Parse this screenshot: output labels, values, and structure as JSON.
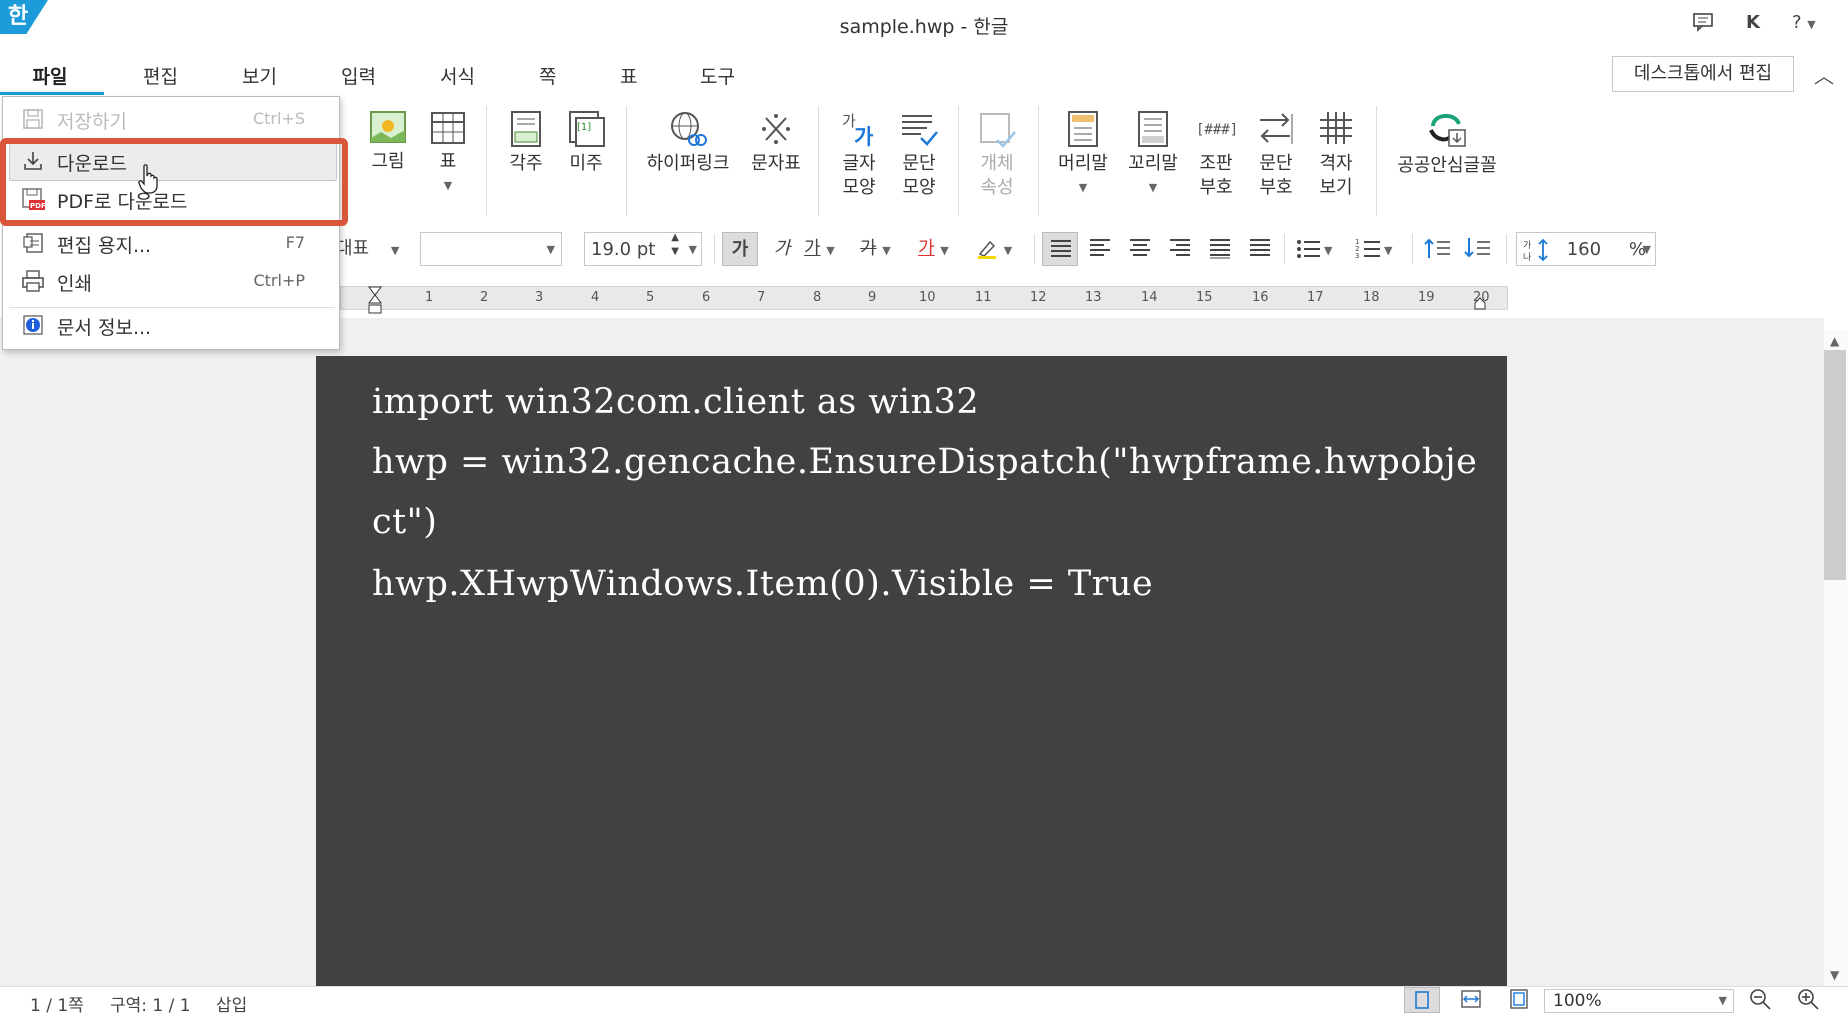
{
  "window": {
    "title": "sample.hwp - 한글",
    "app_logo": "한",
    "user_initial": "K",
    "help_label": "?"
  },
  "menu": {
    "tabs": [
      "파일",
      "편집",
      "보기",
      "입력",
      "서식",
      "쪽",
      "표",
      "도구"
    ],
    "desktop_edit": "데스크톱에서 편집"
  },
  "ribbon": {
    "picture": "그림",
    "table": "표",
    "footnote": "각주",
    "endnote": "미주",
    "hyperlink": "하이퍼링크",
    "char_map": "문자표",
    "char_shape_l1": "글자",
    "char_shape_l2": "모양",
    "para_shape_l1": "문단",
    "para_shape_l2": "모양",
    "obj_props_l1": "개체",
    "obj_props_l2": "속성",
    "header": "머리말",
    "footer": "꼬리말",
    "markup_l1": "조판",
    "markup_l2": "부호",
    "para_mark_l1": "문단",
    "para_mark_l2": "부호",
    "grid_l1": "격자",
    "grid_l2": "보기",
    "public_font": "공공안심글꼴"
  },
  "formatbar": {
    "style_partial": "대표",
    "font_name": "",
    "font_size": "19.0",
    "font_unit": "pt",
    "bold": "가",
    "italic": "가",
    "underline": "가",
    "strike": "가",
    "color": "가",
    "line_spacing": "160",
    "line_spacing_unit": "%"
  },
  "ruler": {
    "numbers": [
      "1",
      "2",
      "3",
      "4",
      "5",
      "6",
      "7",
      "8",
      "9",
      "10",
      "11",
      "12",
      "13",
      "14",
      "15",
      "16",
      "17",
      "18",
      "19",
      "20"
    ]
  },
  "document": {
    "lines": [
      "import  win32com.client  as  win32",
      "hwp  =  win32.gencache.EnsureDispatch(\"hwpframe.hwpobje",
      "ct\")",
      "hwp.XHwpWindows.Item(0).Visible  =  True"
    ]
  },
  "file_menu": {
    "items": [
      {
        "label": "저장하기",
        "shortcut": "Ctrl+S",
        "icon": "save-icon",
        "disabled": true
      },
      {
        "label": "다운로드",
        "shortcut": "",
        "icon": "download-icon",
        "disabled": false
      },
      {
        "label": "PDF로 다운로드",
        "shortcut": "",
        "icon": "pdf-icon",
        "disabled": false
      },
      {
        "label": "편집 용지...",
        "shortcut": "F7",
        "icon": "page-setup-icon",
        "disabled": false
      },
      {
        "label": "인쇄",
        "shortcut": "Ctrl+P",
        "icon": "print-icon",
        "disabled": false
      },
      {
        "label": "문서 정보...",
        "shortcut": "",
        "icon": "info-icon",
        "disabled": false
      }
    ]
  },
  "status": {
    "page": "1 / 1쪽",
    "section": "구역: 1 / 1",
    "mode": "삽입",
    "zoom": "100%"
  },
  "colors": {
    "accent": "#1d9bd8",
    "highlight": "#d9563a",
    "page_bg": "#414141",
    "code_text": "#ffffff"
  }
}
